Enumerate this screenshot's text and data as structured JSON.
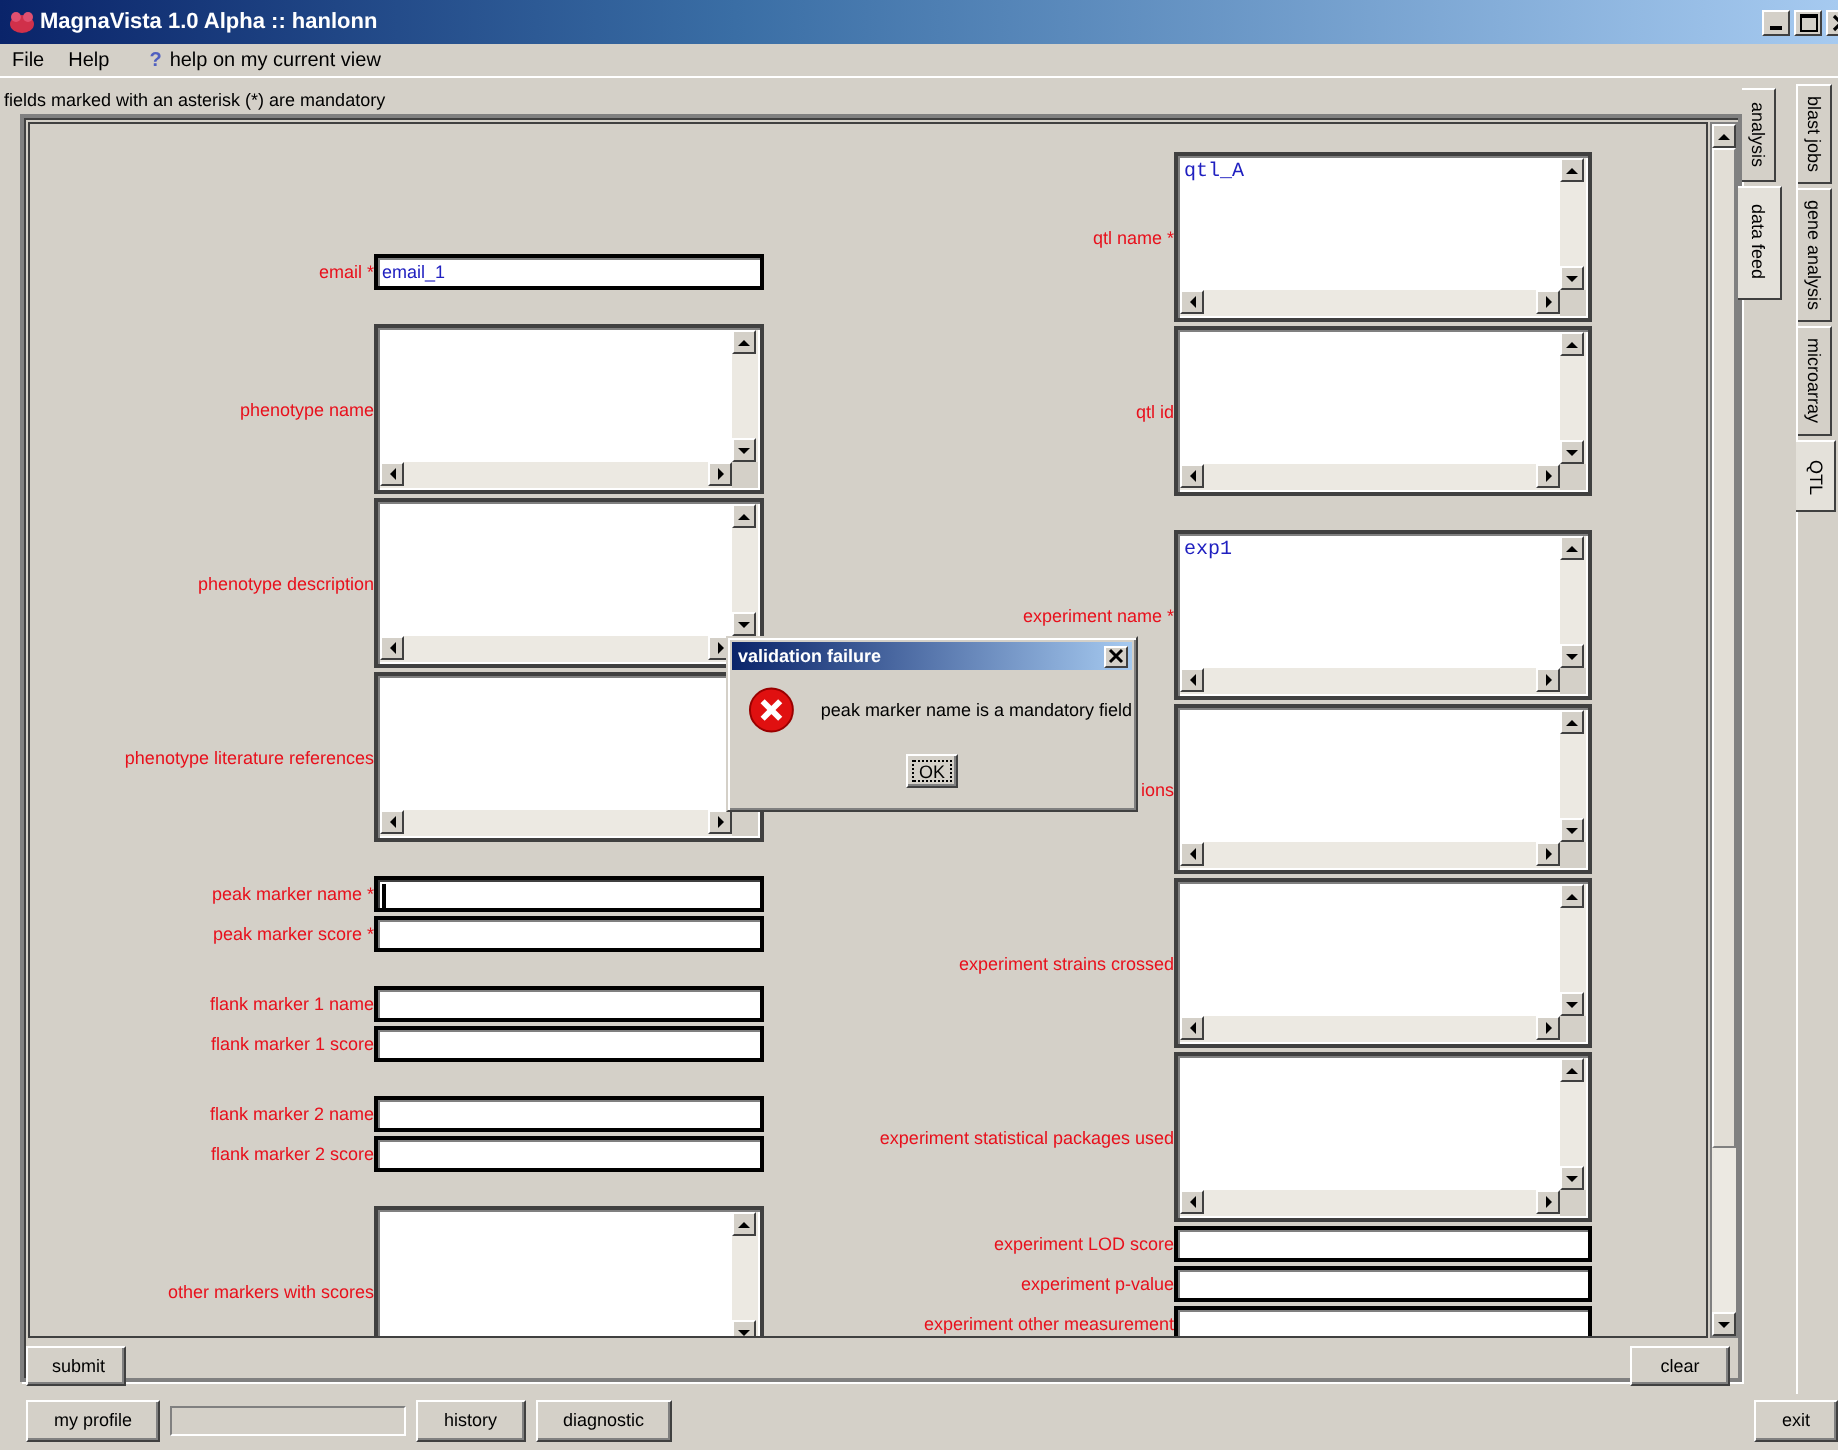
{
  "window": {
    "title": "MagnaVista 1.0 Alpha :: hanlonn"
  },
  "menu": [
    {
      "label": "File"
    },
    {
      "label": "Help"
    }
  ],
  "help_link": {
    "icon": "?",
    "label": "help on my current view"
  },
  "note": "fields marked with an asterisk (*) are mandatory",
  "form": {
    "left_groups": [
      [
        {
          "kind": "line",
          "label": "email *",
          "value": "email_1",
          "focused": false
        }
      ],
      [
        {
          "kind": "area",
          "label": "phenotype name",
          "focused": false
        },
        {
          "kind": "area",
          "label": "phenotype description",
          "focused": false
        },
        {
          "kind": "area",
          "label": "phenotype literature references",
          "focused": false
        }
      ],
      [
        {
          "kind": "line",
          "label": "peak marker name *",
          "focused": true
        },
        {
          "kind": "line",
          "label": "peak marker score *",
          "focused": false
        }
      ],
      [
        {
          "kind": "line",
          "label": "flank marker 1 name",
          "focused": false
        },
        {
          "kind": "line",
          "label": "flank marker 1 score",
          "focused": false
        }
      ],
      [
        {
          "kind": "line",
          "label": "flank marker 2 name",
          "focused": false
        },
        {
          "kind": "line",
          "label": "flank marker 2 score",
          "focused": false
        }
      ],
      [
        {
          "kind": "area",
          "label": "other markers with scores",
          "focused": false
        }
      ]
    ],
    "right_groups": [
      [
        {
          "kind": "area",
          "label": "qtl name *",
          "value": "qtl_A",
          "focused": false
        },
        {
          "kind": "area",
          "label": "qtl id",
          "focused": false
        }
      ],
      [
        {
          "kind": "area",
          "label": "experiment name *",
          "value": "exp1",
          "focused": false
        },
        {
          "kind": "area",
          "label": "ions",
          "focused": false
        },
        {
          "kind": "area",
          "label": "experiment strains crossed",
          "focused": false
        },
        {
          "kind": "area",
          "label": "experiment statistical packages used",
          "focused": false
        },
        {
          "kind": "line",
          "label": "experiment LOD score",
          "focused": false
        },
        {
          "kind": "line",
          "label": "experiment p-value",
          "focused": false
        },
        {
          "kind": "line",
          "label": "experiment other measurement",
          "focused": false
        }
      ]
    ]
  },
  "form_buttons": [
    {
      "label": "submit",
      "kind": "left"
    },
    {
      "label": "clear",
      "kind": "right"
    }
  ],
  "inner_tabs": [
    {
      "label": "analysis",
      "selected": false
    },
    {
      "label": "data feed",
      "selected": true
    }
  ],
  "outer_tabs": [
    {
      "label": "blast jobs",
      "selected": false
    },
    {
      "label": "gene analysis",
      "selected": false
    },
    {
      "label": "microarray",
      "selected": false
    },
    {
      "label": "QTL",
      "selected": true
    }
  ],
  "dialog": {
    "title": "validation failure",
    "message": "peak marker name is a mandatory field",
    "button": "OK"
  },
  "bottom_bar": [
    {
      "kind": "button",
      "label": "my profile"
    },
    {
      "kind": "status"
    },
    {
      "kind": "button",
      "label": "history"
    },
    {
      "kind": "button",
      "label": "diagnostic"
    },
    {
      "kind": "spacer"
    },
    {
      "kind": "button",
      "label": "exit"
    }
  ]
}
